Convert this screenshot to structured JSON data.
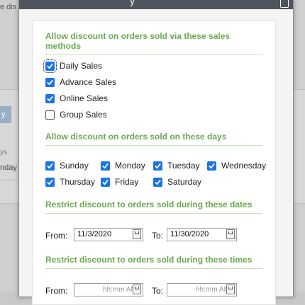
{
  "background": {
    "top_text": "e dis",
    "tab_label": "y",
    "ys_label": "ys",
    "nday_label": "nday"
  },
  "dialog": {
    "title_fragment": "y",
    "sections": {
      "sales_methods": {
        "title": "Allow discount on orders sold via these sales methods",
        "options": [
          {
            "label": "Daily Sales",
            "checked": true
          },
          {
            "label": "Advance Sales",
            "checked": true
          },
          {
            "label": "Online Sales",
            "checked": true
          },
          {
            "label": "Group Sales",
            "checked": false
          }
        ]
      },
      "days": {
        "title": "Allow discount on orders sold on these days",
        "options": [
          {
            "label": "Sunday",
            "checked": true
          },
          {
            "label": "Monday",
            "checked": true
          },
          {
            "label": "Tuesday",
            "checked": true
          },
          {
            "label": "Wednesday",
            "checked": true
          },
          {
            "label": "Thursday",
            "checked": true
          },
          {
            "label": "Friday",
            "checked": true
          },
          {
            "label": "Saturday",
            "checked": true
          }
        ]
      },
      "dates": {
        "title": "Restrict discount to orders sold during these dates",
        "from_label": "From:",
        "from_value": "11/3/2020",
        "to_label": "To:",
        "to_value": "11/30/2020"
      },
      "times": {
        "title": "Restrict discount to orders sold during these times",
        "from_label": "From:",
        "from_placeholder": "hh:mm AM",
        "to_label": "To:",
        "to_placeholder": "hh:mm AM"
      }
    }
  },
  "colors": {
    "accent_green": "#6aa84f",
    "checkbox_blue": "#1a73e8",
    "titlebar": "#4f555e"
  }
}
